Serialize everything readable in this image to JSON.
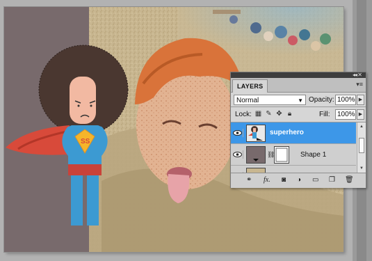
{
  "layers_panel": {
    "tab_label": "LAYERS",
    "blend_mode": "Normal",
    "opacity_label": "Opacity:",
    "opacity_value": "100%",
    "lock_label": "Lock:",
    "fill_label": "Fill:",
    "fill_value": "100%",
    "layers": [
      {
        "name": "superhero",
        "selected": true
      },
      {
        "name": "Shape 1",
        "selected": false
      }
    ],
    "footer_icons": [
      "link-layers-icon",
      "fx-icon",
      "layer-mask-icon",
      "adjustment-layer-icon",
      "new-group-icon",
      "new-layer-icon",
      "trash-icon"
    ]
  },
  "colors": {
    "selection": "#3d97e8",
    "panel_bg": "#d6d6d6",
    "canvas_backdrop": "#786a6c",
    "hair": "#4a3730",
    "cape": "#d84a3a",
    "suit": "#3c9ad2"
  }
}
